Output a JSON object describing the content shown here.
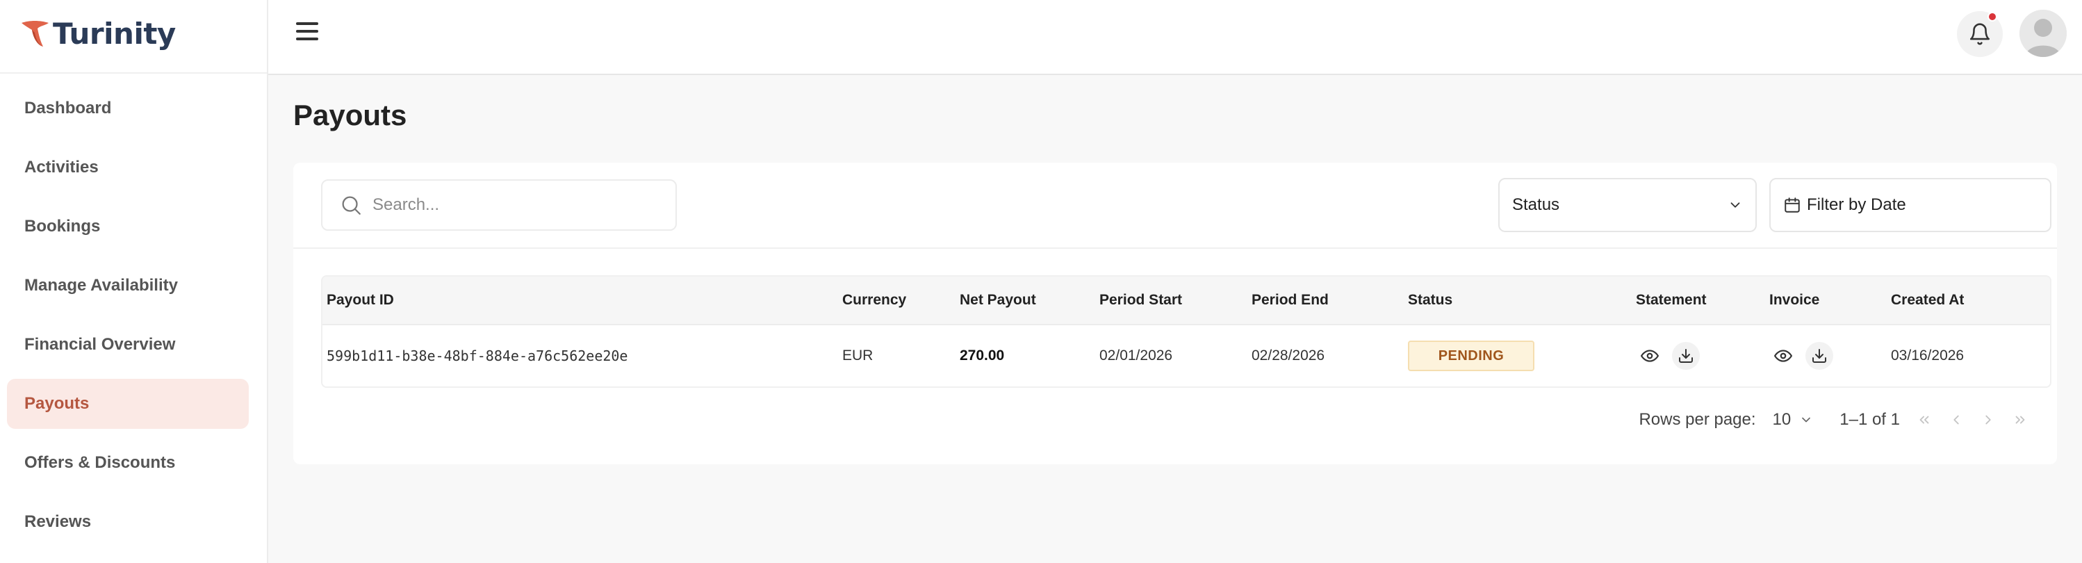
{
  "app": {
    "name": "Turinity",
    "brand_color": "#e0644a",
    "logo_text_color": "#2b3b57"
  },
  "sidebar": {
    "items": [
      {
        "label": "Dashboard",
        "active": false
      },
      {
        "label": "Activities",
        "active": false
      },
      {
        "label": "Bookings",
        "active": false
      },
      {
        "label": "Manage Availability",
        "active": false
      },
      {
        "label": "Financial Overview",
        "active": false
      },
      {
        "label": "Payouts",
        "active": true
      },
      {
        "label": "Offers & Discounts",
        "active": false
      },
      {
        "label": "Reviews",
        "active": false
      }
    ],
    "active_bg": "#fbe9e5",
    "active_color": "#b55740"
  },
  "header": {
    "menu_icon": "hamburger-icon",
    "notification_icon": "bell-icon",
    "notification_dot_color": "#d9343a",
    "avatar_icon": "user-avatar-icon"
  },
  "page": {
    "title": "Payouts"
  },
  "filters": {
    "search_placeholder": "Search...",
    "status_label": "Status",
    "date_label": "Filter by Date"
  },
  "table": {
    "columns": [
      "Payout ID",
      "Currency",
      "Net Payout",
      "Period Start",
      "Period End",
      "Status",
      "Statement",
      "Invoice",
      "Created At"
    ],
    "rows": [
      {
        "payout_id": "599b1d11-b38e-48bf-884e-a76c562ee20e",
        "currency": "EUR",
        "net_payout": "270.00",
        "period_start": "02/01/2026",
        "period_end": "02/28/2026",
        "status": "PENDING",
        "created_at": "03/16/2026"
      }
    ]
  },
  "pagination": {
    "rows_per_page_label": "Rows per page:",
    "rows_per_page_value": "10",
    "range": "1–1 of 1"
  }
}
